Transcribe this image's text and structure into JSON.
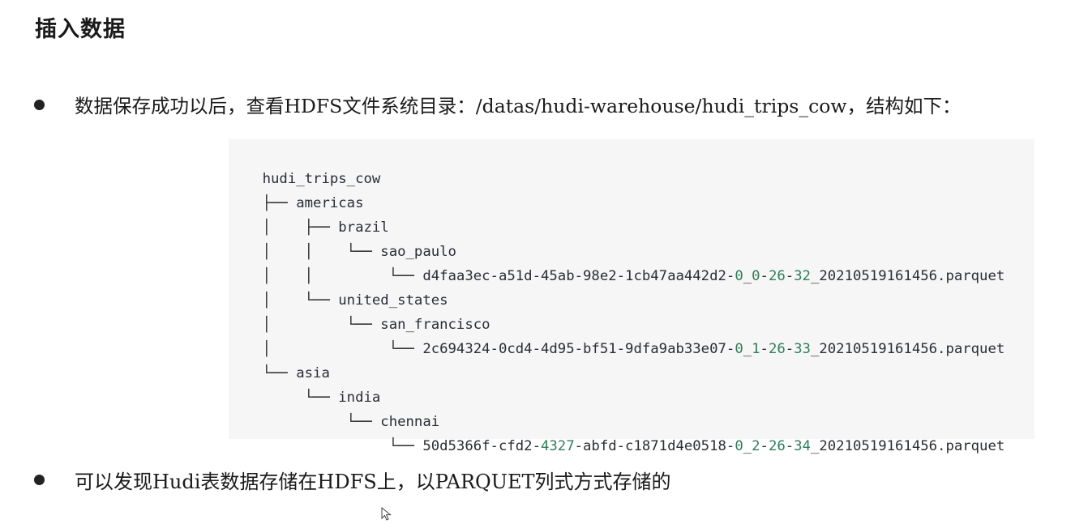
{
  "heading": "插入数据",
  "bullets": [
    {
      "text": "数据保存成功以后，查看HDFS文件系统目录：/datas/hudi-warehouse/hudi_trips_cow，结构如下："
    },
    {
      "text": "可以发现Hudi表数据存储在HDFS上，以PARQUET列式方式存储的"
    }
  ],
  "tree": {
    "root": "hudi_trips_cow",
    "lines": [
      {
        "prefix": "├── ",
        "name": "americas"
      },
      {
        "prefix": "│    ├── ",
        "name": "brazil"
      },
      {
        "prefix": "│    │    └── ",
        "name": "sao_paulo"
      },
      {
        "prefix": "│    │         └── ",
        "name": "d4faa3ec-a51d-45ab-98e2-1cb47aa442d2-0_0-26-32_20210519161456.parquet"
      },
      {
        "prefix": "│    └── ",
        "name": "united_states"
      },
      {
        "prefix": "│         └── ",
        "name": "san_francisco"
      },
      {
        "prefix": "│              └── ",
        "name": "2c694324-0cd4-4d95-bf51-9dfa9ab33e07-0_1-26-33_20210519161456.parquet"
      },
      {
        "prefix": "└── ",
        "name": "asia"
      },
      {
        "prefix": "     └── ",
        "name": "india"
      },
      {
        "prefix": "          └── ",
        "name": "chennai"
      },
      {
        "prefix": "               └── ",
        "name": "50d5366f-cfd2-4327-abfd-c1871d4e0518-0_2-26-34_20210519161456.parquet"
      }
    ]
  }
}
